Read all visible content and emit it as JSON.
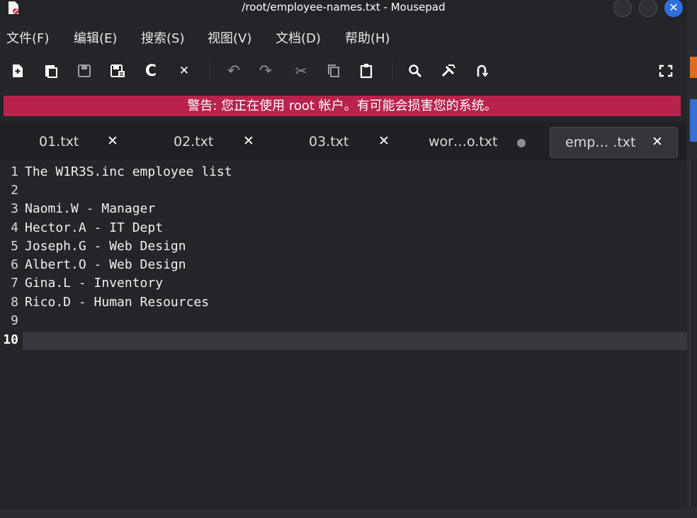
{
  "window": {
    "title": "/root/employee-names.txt - Mousepad",
    "app_icon": "mousepad-document-icon",
    "controls": [
      "minimize-icon",
      "maximize-icon",
      "close-icon"
    ],
    "close_glyph": "✕"
  },
  "menubar": {
    "items": [
      "文件(F)",
      "编辑(E)",
      "搜索(S)",
      "视图(V)",
      "文档(D)",
      "帮助(H)"
    ]
  },
  "toolbar": {
    "buttons": [
      {
        "icon": "new-document-icon"
      },
      {
        "icon": "new-window-icon"
      },
      {
        "icon": "save-icon"
      },
      {
        "icon": "save-as-icon"
      },
      {
        "icon": "reload-icon",
        "glyph": "C"
      },
      {
        "icon": "close-document-icon",
        "glyph": "✕"
      },
      {
        "icon": "undo-icon",
        "glyph": "↶"
      },
      {
        "icon": "redo-icon",
        "glyph": "↷"
      },
      {
        "icon": "cut-icon",
        "glyph": "✂"
      },
      {
        "icon": "copy-icon"
      },
      {
        "icon": "paste-icon"
      },
      {
        "icon": "search-icon"
      },
      {
        "icon": "find-replace-icon"
      },
      {
        "icon": "go-to-icon"
      },
      {
        "icon": "fullscreen-icon"
      }
    ]
  },
  "warning": {
    "text": "警告: 您正在使用 root 帐户。有可能会损害您的系统。",
    "color": "#b8234c"
  },
  "tabs": [
    {
      "label": "01.txt",
      "close": "✕",
      "modified": false,
      "active": false
    },
    {
      "label": "02.txt",
      "close": "✕",
      "modified": false,
      "active": false
    },
    {
      "label": "03.txt",
      "close": "✕",
      "modified": false,
      "active": false
    },
    {
      "label": "wor…o.txt",
      "close": "",
      "modified": true,
      "active": false
    },
    {
      "label": "emp… .txt",
      "close": "✕",
      "modified": false,
      "active": true
    }
  ],
  "editor": {
    "current_line": 10,
    "lines": [
      {
        "n": "1",
        "text": "The W1R3S.inc employee list"
      },
      {
        "n": "2",
        "text": ""
      },
      {
        "n": "3",
        "text": "Naomi.W - Manager"
      },
      {
        "n": "4",
        "text": "Hector.A - IT Dept"
      },
      {
        "n": "5",
        "text": "Joseph.G - Web Design"
      },
      {
        "n": "6",
        "text": "Albert.O - Web Design"
      },
      {
        "n": "7",
        "text": "Gina.L - Inventory"
      },
      {
        "n": "8",
        "text": "Rico.D - Human Resources"
      },
      {
        "n": "9",
        "text": ""
      },
      {
        "n": "10",
        "text": ""
      }
    ]
  }
}
